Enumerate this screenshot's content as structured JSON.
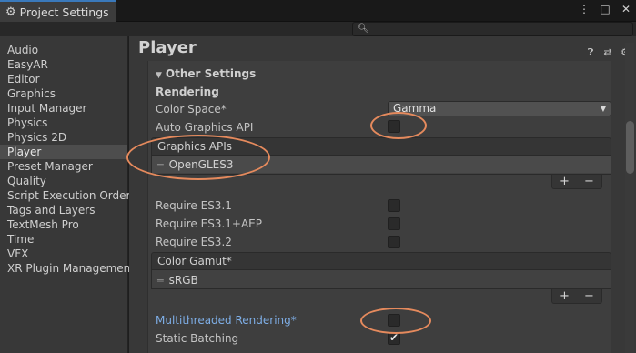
{
  "window": {
    "tab_title": "Project Settings",
    "tab_icon": "gear-icon"
  },
  "search": {
    "placeholder": "",
    "icon": "search-icon"
  },
  "sidebar": {
    "items": [
      {
        "label": "Audio",
        "selected": false
      },
      {
        "label": "EasyAR",
        "selected": false
      },
      {
        "label": "Editor",
        "selected": false
      },
      {
        "label": "Graphics",
        "selected": false
      },
      {
        "label": "Input Manager",
        "selected": false
      },
      {
        "label": "Physics",
        "selected": false
      },
      {
        "label": "Physics 2D",
        "selected": false
      },
      {
        "label": "Player",
        "selected": true
      },
      {
        "label": "Preset Manager",
        "selected": false
      },
      {
        "label": "Quality",
        "selected": false
      },
      {
        "label": "Script Execution Order",
        "selected": false
      },
      {
        "label": "Tags and Layers",
        "selected": false
      },
      {
        "label": "TextMesh Pro",
        "selected": false
      },
      {
        "label": "Time",
        "selected": false
      },
      {
        "label": "VFX",
        "selected": false
      },
      {
        "label": "XR Plugin Management",
        "selected": false
      }
    ]
  },
  "main": {
    "title": "Player",
    "section": "Other Settings",
    "subsection": "Rendering",
    "color_space": {
      "label": "Color Space*",
      "value": "Gamma"
    },
    "auto_graphics_api": {
      "label": "Auto Graphics API",
      "checked": false
    },
    "graphics_apis": {
      "header": "Graphics APIs",
      "items": [
        "OpenGLES3"
      ]
    },
    "require_es31": {
      "label": "Require ES3.1",
      "checked": false
    },
    "require_es31_aep": {
      "label": "Require ES3.1+AEP",
      "checked": false
    },
    "require_es32": {
      "label": "Require ES3.2",
      "checked": false
    },
    "color_gamut": {
      "header": "Color Gamut*",
      "items": [
        "sRGB"
      ]
    },
    "multithreaded_rendering": {
      "label": "Multithreaded Rendering*",
      "checked": false
    },
    "static_batching": {
      "label": "Static Batching",
      "checked": true
    },
    "list_add": "+",
    "list_remove": "−",
    "link_color": "#7eaee6"
  },
  "annotations": {
    "highlight_color": "#e58a5d"
  }
}
